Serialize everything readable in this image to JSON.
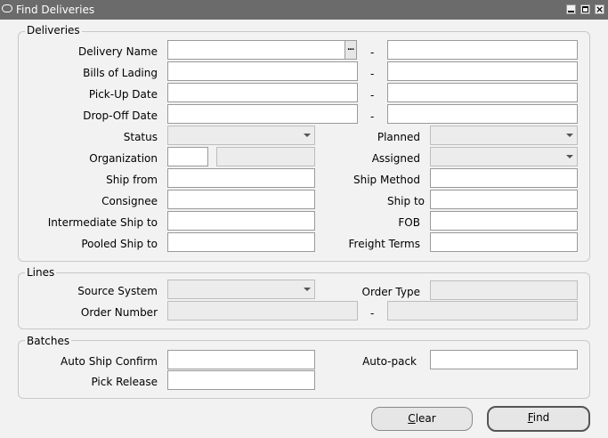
{
  "window": {
    "title": "Find Deliveries"
  },
  "deliveries": {
    "legend": "Deliveries",
    "delivery_name": "Delivery Name",
    "bills_of_lading": "Bills of Lading",
    "pick_up_date": "Pick-Up Date",
    "drop_off_date": "Drop-Off Date",
    "status": "Status",
    "planned": "Planned",
    "organization": "Organization",
    "assigned": "Assigned",
    "ship_from": "Ship from",
    "ship_method": "Ship Method",
    "consignee": "Consignee",
    "ship_to": "Ship to",
    "intermediate_ship_to": "Intermediate Ship to",
    "fob": "FOB",
    "pooled_ship_to": "Pooled Ship to",
    "freight_terms": "Freight Terms",
    "range_dash": "-",
    "lov_glyph": "..."
  },
  "lines": {
    "legend": "Lines",
    "source_system": "Source System",
    "order_type": "Order Type",
    "order_number": "Order Number",
    "range_dash": "-"
  },
  "batches": {
    "legend": "Batches",
    "auto_ship_confirm": "Auto Ship Confirm",
    "auto_pack": "Auto-pack",
    "pick_release": "Pick Release"
  },
  "buttons": {
    "clear_mnemonic": "C",
    "clear_rest": "lear",
    "find_mnemonic": "F",
    "find_rest": "ind"
  }
}
